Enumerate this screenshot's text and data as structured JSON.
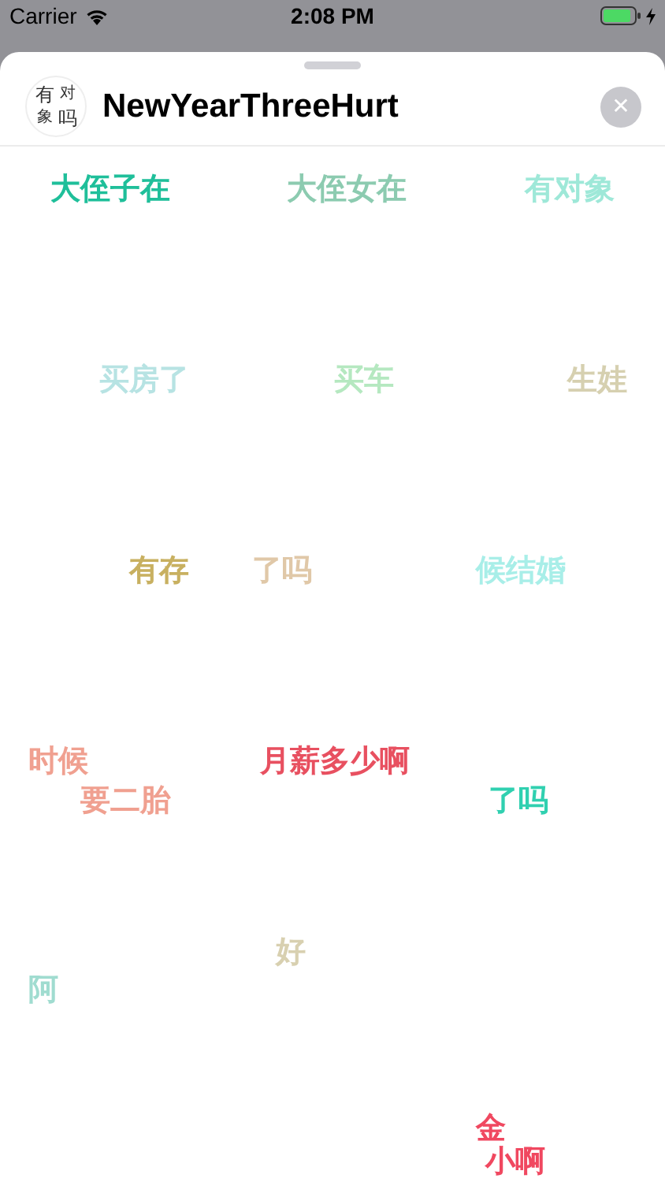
{
  "status_bar": {
    "carrier": "Carrier",
    "time": "2:08 PM"
  },
  "header": {
    "icon_text": [
      "有",
      "对",
      "象",
      "吗"
    ],
    "title": "NewYearThreeHurt",
    "close": "✕"
  },
  "stickers": [
    {
      "lines": [
        "大侄子在"
      ],
      "color": "#1fbf9a"
    },
    {
      "lines": [
        "大侄女在"
      ],
      "color": "#8ccbb0"
    },
    {
      "lines": [
        "有对象"
      ],
      "color": "#9ee8d8"
    },
    {
      "lines": [
        "买房了"
      ],
      "color": "#b7e3e3"
    },
    {
      "lines": [
        "买车"
      ],
      "color": "#b5e8c0"
    },
    {
      "lines": [
        "生娃"
      ],
      "color": "#d6d0b0"
    },
    {
      "lines": [
        "有存"
      ],
      "color": "#c8b060"
    },
    {
      "lines": [
        "了吗"
      ],
      "color": "#e0c8a8"
    },
    {
      "lines": [
        "候结婚"
      ],
      "color": "#a8eee8"
    },
    {
      "lines": [
        "时候",
        "要二胎"
      ],
      "color": "#f0a090"
    },
    {
      "lines": [
        "月薪多少啊"
      ],
      "color": "#e85060"
    },
    {
      "lines": [
        "了吗"
      ],
      "color": "#30d0b0"
    },
    {
      "lines": [
        "阿"
      ],
      "color": "#a0dcd0"
    },
    {
      "lines": [
        "好"
      ],
      "color": "#d8d0b0"
    },
    {
      "lines": [
        "金",
        "小啊"
      ],
      "color": "#f04860"
    }
  ]
}
